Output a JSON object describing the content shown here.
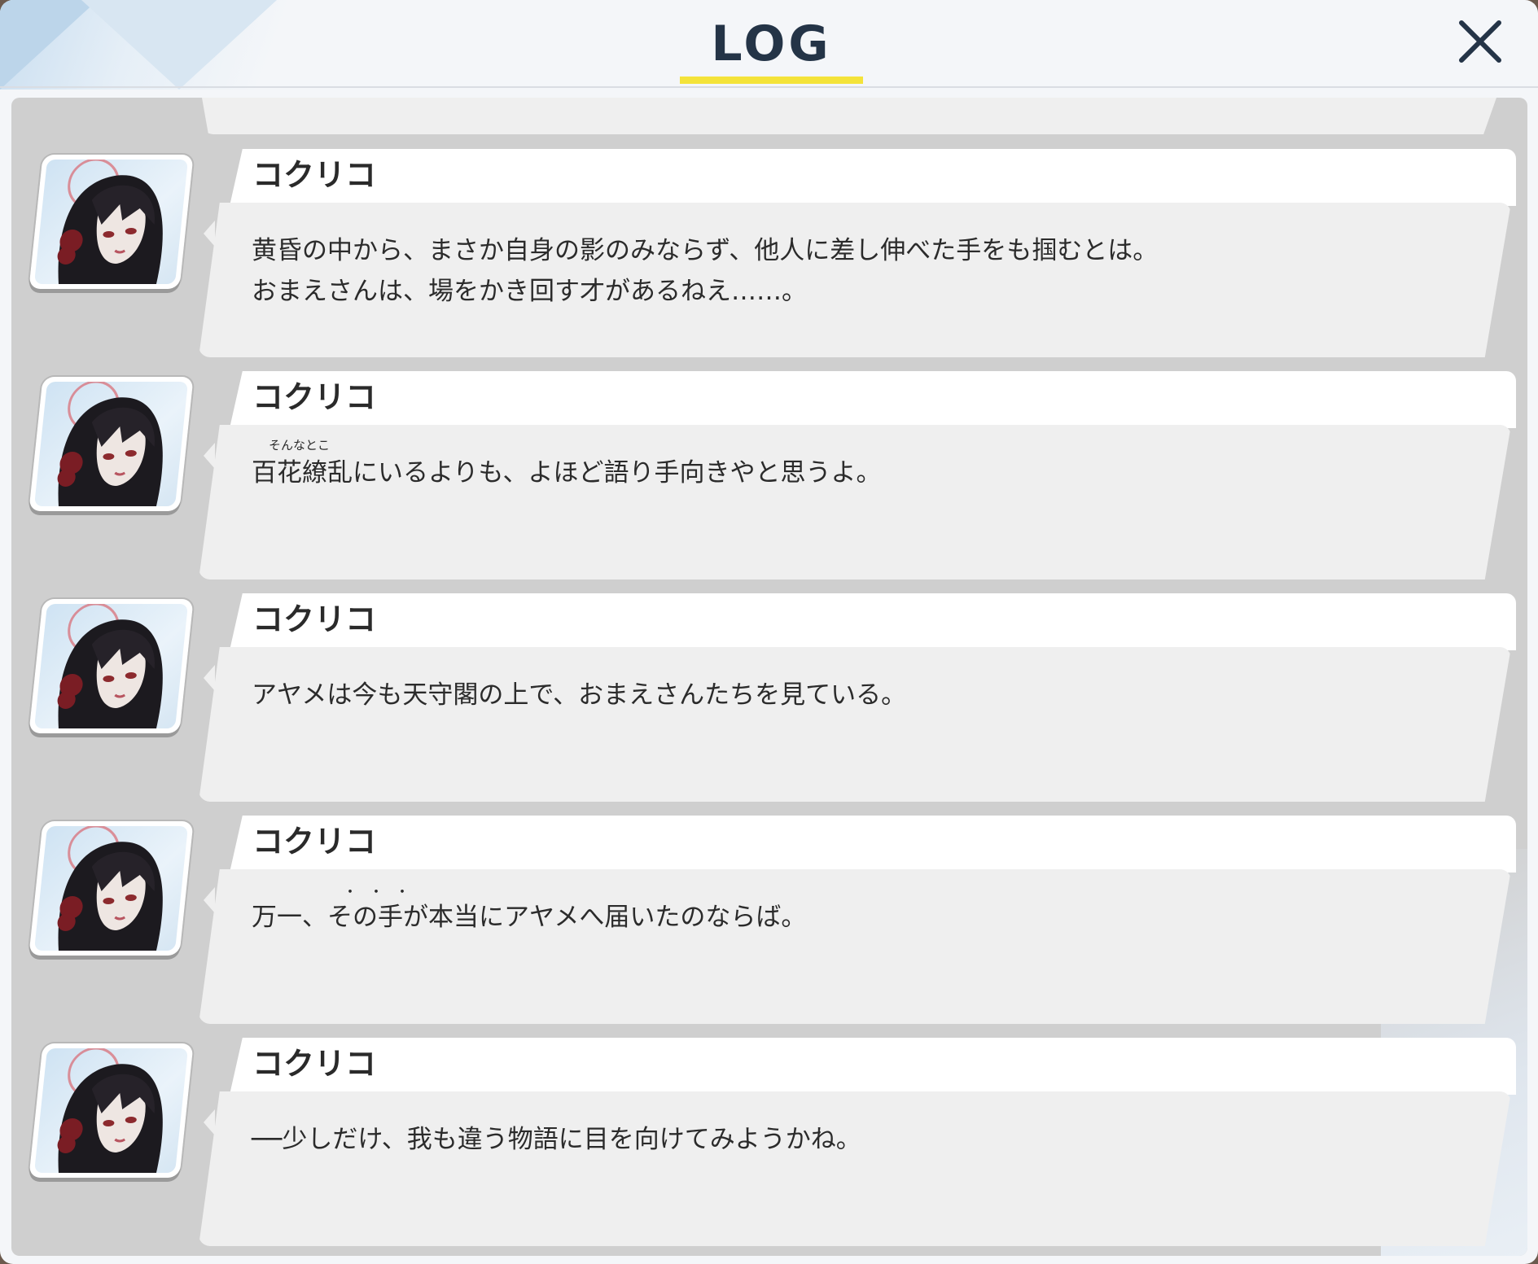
{
  "header": {
    "title": "LOG"
  },
  "log": {
    "entries": [
      {
        "speaker": "コクリコ",
        "text": "黄昏の中から、まさか自身の影のみならず、他人に差し伸べた手をも掴むとは。\nおまえさんは、場をかき回す才があるねえ……。"
      },
      {
        "speaker": "コクリコ",
        "ruby": "そんなとこ",
        "text": "百花繚乱にいるよりも、よほど語り手向きやと思うよ。"
      },
      {
        "speaker": "コクリコ",
        "text": "アヤメは今も天守閣の上で、おまえさんたちを見ている。"
      },
      {
        "speaker": "コクリコ",
        "emphasis_marks": "・・・",
        "text": "万一、その手が本当にアヤメへ届いたのならば。"
      },
      {
        "speaker": "コクリコ",
        "text": "──少しだけ、我も違う物語に目を向けてみようかね。"
      }
    ]
  },
  "colors": {
    "accent_underline": "#f4e33a",
    "title_text": "#243447"
  }
}
